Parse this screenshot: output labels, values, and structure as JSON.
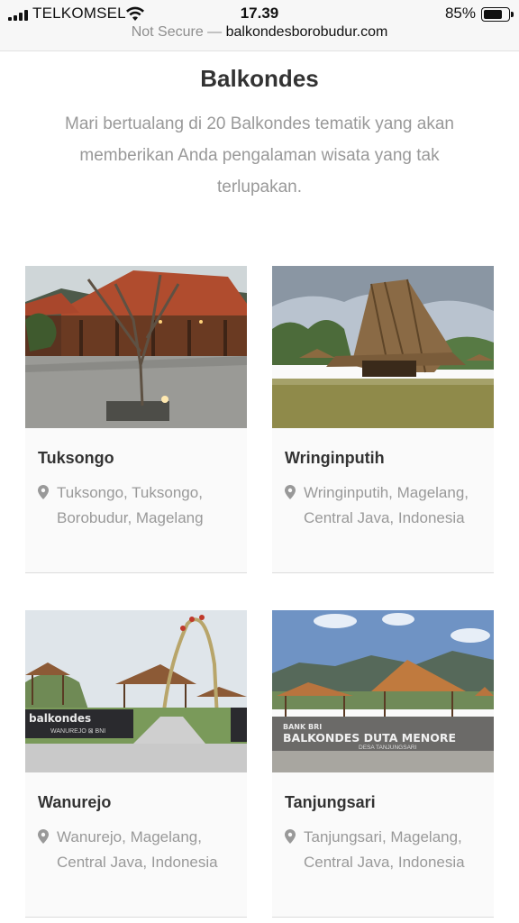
{
  "status_bar": {
    "carrier": "TELKOMSEL",
    "time": "17.39",
    "battery": "85%",
    "battery_level": 0.85
  },
  "address_bar": {
    "security": "Not Secure —",
    "domain": "balkondesborobudur.com"
  },
  "section": {
    "title": "Balkondes",
    "intro": "Mari bertualang di 20 Balkondes tematik yang akan memberikan Anda pengalaman wisata yang tak terlupakan."
  },
  "cards": [
    {
      "name": "Tuksongo",
      "location": "Tuksongo, Tuksongo, Borobudur, Magelang",
      "icon": "location-pin-icon"
    },
    {
      "name": "Wringinputih",
      "location": "Wringinputih, Magelang, Central Java, Indonesia",
      "icon": "location-pin-icon"
    },
    {
      "name": "Wanurejo",
      "location": "Wanurejo, Magelang, Central Java, Indonesia",
      "icon": "location-pin-icon",
      "image_sign": "balkondes",
      "image_sign_sub": "WANUREJO ⊠ BNI"
    },
    {
      "name": "Tanjungsari",
      "location": "Tanjungsari, Magelang, Central Java, Indonesia",
      "icon": "location-pin-icon",
      "image_sign_top": "BANK BRI",
      "image_sign": "BALKONDES DUTA MENORE",
      "image_sign_sub": "DESA TANJUNGSARI"
    }
  ],
  "colors": {
    "heading": "#333333",
    "muted": "#999999",
    "card_bg": "#fafafa"
  }
}
